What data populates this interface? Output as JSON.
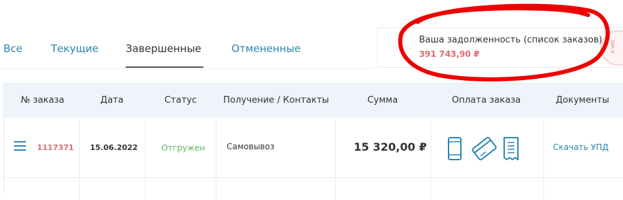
{
  "tabs": [
    {
      "label": "Все"
    },
    {
      "label": "Текущие"
    },
    {
      "label": "Завершенные",
      "active": true
    },
    {
      "label": "Отмененные"
    }
  ],
  "debt": {
    "label": "Ваша задолженность (список заказов)",
    "amount": "391 743,90 ₽",
    "alert_icon": "!"
  },
  "table": {
    "headers": [
      "№ заказа",
      "Дата",
      "Статус",
      "Получение / Контакты",
      "Сумма",
      "Оплата заказа",
      "Документы"
    ],
    "rows": [
      {
        "order_number": "1117371",
        "date": "15.06.2022",
        "status": "Отгружен",
        "delivery": "Самовывоз",
        "sum": "15 320,00 ₽",
        "payment_icons": [
          "phone-icon",
          "credit-card-icon",
          "receipt-icon"
        ],
        "documents": "Скачать УПД"
      }
    ]
  },
  "colors": {
    "accent": "#2a86b0",
    "debt_red": "#e26a6a",
    "status_green": "#5cb85c",
    "annotation_red": "#ee0000",
    "header_bg": "#eef4f9"
  }
}
